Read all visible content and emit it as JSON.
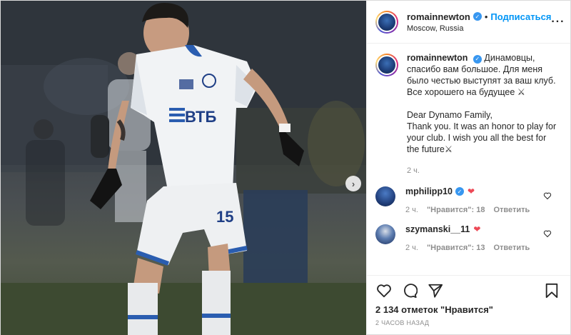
{
  "post": {
    "username": "romainnewton",
    "location": "Moscow, Russia",
    "follow_label": "Подписаться",
    "dot": "•",
    "more_label": "···",
    "caption": "Динамовцы, спасибо вам большое. Для меня было честью выступят за ваш клуб. Все хорошего на будущее ⚔\n\nDear Dynamo Family,\nThank you. It was an honor to play for your club. I wish you all the best for the future⚔",
    "caption_time": "2 ч."
  },
  "photo": {
    "jersey_sponsor": "ВТБ",
    "jersey_number": "15",
    "carousel_next": "›"
  },
  "comments": [
    {
      "username": "mphilipp10",
      "text": "❤",
      "time": "2 ч.",
      "likes": "\"Нравится\": 18",
      "reply": "Ответить"
    },
    {
      "username": "szymanski__11",
      "text": "❤",
      "time": "2 ч.",
      "likes": "\"Нравится\": 13",
      "reply": "Ответить"
    }
  ],
  "footer": {
    "likes_text": "2 134 отметок \"Нравится\"",
    "timestamp": "2 часов назад"
  },
  "icons": {
    "verified": "✓",
    "heart": "heart-icon",
    "comment": "comment-icon",
    "share": "share-icon",
    "save": "bookmark-icon"
  },
  "colors": {
    "follow": "#0095f6",
    "verified": "#3897f0",
    "heart_red": "#ed4956",
    "muted": "#8e8e8e"
  }
}
